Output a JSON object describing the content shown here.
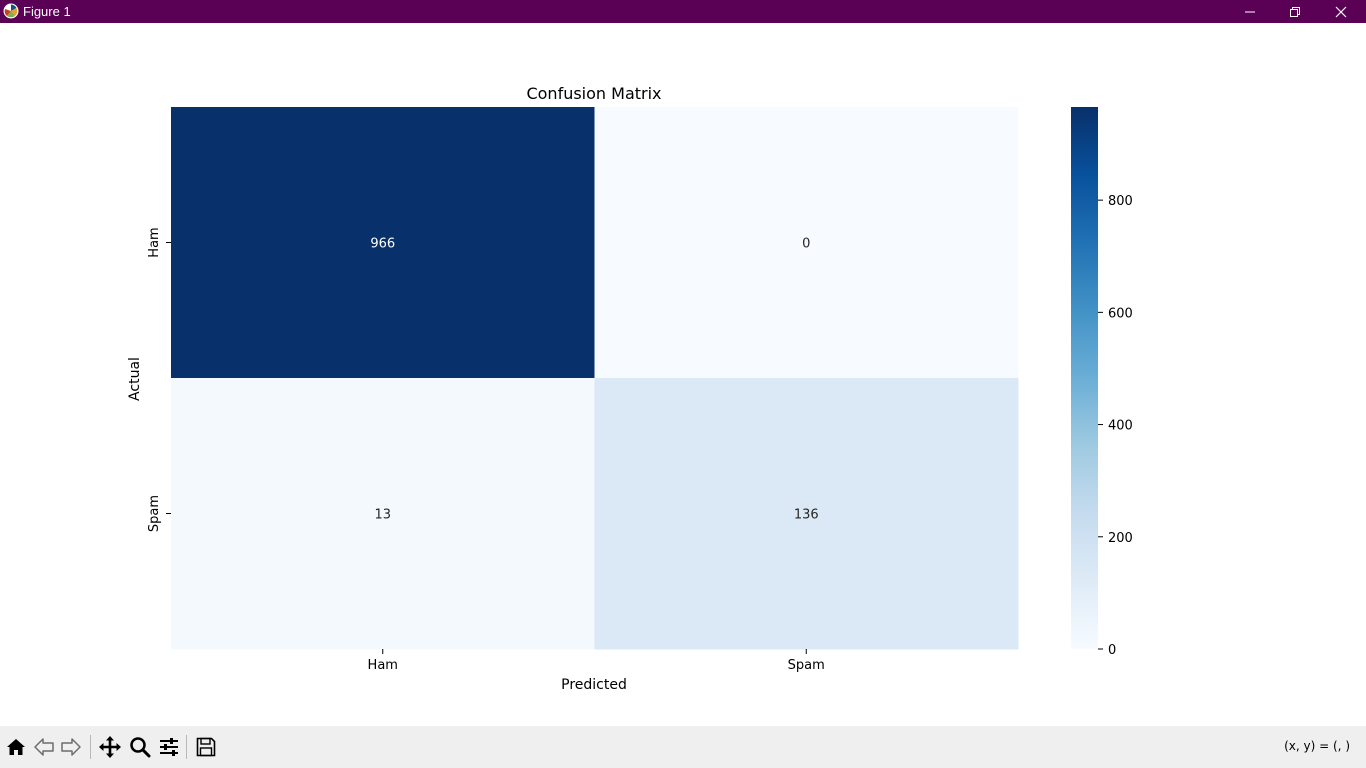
{
  "window": {
    "title": "Figure 1",
    "titlebar_color": "#5a0055"
  },
  "chart_data": {
    "type": "heatmap",
    "title": "Confusion Matrix",
    "xlabel": "Predicted",
    "ylabel": "Actual",
    "x_categories": [
      "Ham",
      "Spam"
    ],
    "y_categories": [
      "Ham",
      "Spam"
    ],
    "values": [
      [
        966,
        0
      ],
      [
        13,
        136
      ]
    ],
    "annotations": [
      "966",
      "0",
      "13",
      "136"
    ],
    "colormap": "Blues",
    "colorbar": {
      "range": [
        0,
        966
      ],
      "ticks": [
        0,
        200,
        400,
        600,
        800
      ],
      "tick_labels": [
        "0",
        "200",
        "400",
        "600",
        "800"
      ]
    }
  },
  "toolbar": {
    "icons": [
      "home-icon",
      "back-arrow-icon",
      "forward-arrow-icon",
      "pan-icon",
      "zoom-icon",
      "configure-subplots-icon",
      "save-icon"
    ],
    "coords_text": "(x, y) = (, )"
  }
}
